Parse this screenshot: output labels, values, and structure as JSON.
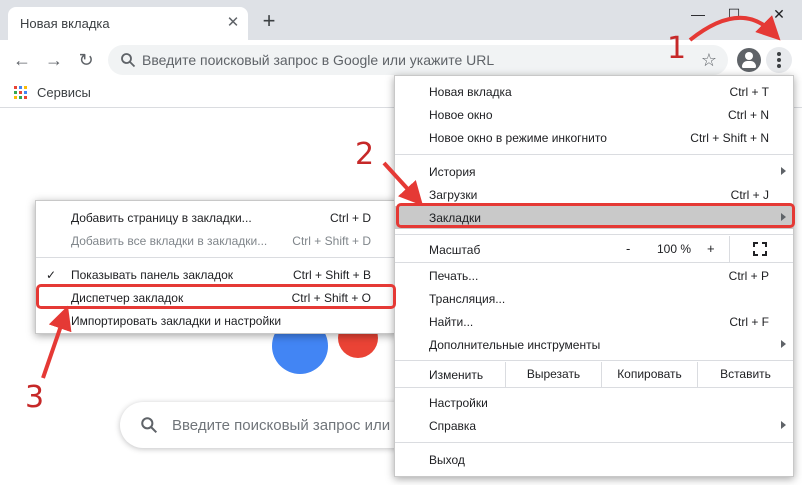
{
  "tab": {
    "title": "Новая вкладка",
    "close": "✕",
    "new_tab": "+"
  },
  "window": {
    "minimize": "—",
    "maximize": "☐",
    "close": "✕"
  },
  "toolbar": {
    "omnibox_placeholder": "Введите поисковый запрос в Google или укажите URL"
  },
  "bookmarks_bar": {
    "apps_label": "Сервисы"
  },
  "page": {
    "search_placeholder": "Введите поисковый запрос или"
  },
  "chrome_menu": {
    "items_top": [
      {
        "label": "Новая вкладка",
        "shortcut": "Ctrl + T"
      },
      {
        "label": "Новое окно",
        "shortcut": "Ctrl + N"
      },
      {
        "label": "Новое окно в режиме инкогнито",
        "shortcut": "Ctrl + Shift + N"
      }
    ],
    "items_mid": [
      {
        "label": "История",
        "shortcut": ""
      },
      {
        "label": "Загрузки",
        "shortcut": "Ctrl + J"
      },
      {
        "label": "Закладки",
        "shortcut": ""
      }
    ],
    "zoom": {
      "label": "Масштаб",
      "minus": "-",
      "value": "100 %",
      "plus": "+"
    },
    "items_tools": [
      {
        "label": "Печать...",
        "shortcut": "Ctrl + P"
      },
      {
        "label": "Трансляция...",
        "shortcut": ""
      },
      {
        "label": "Найти...",
        "shortcut": "Ctrl + F"
      },
      {
        "label": "Дополнительные инструменты",
        "shortcut": ""
      }
    ],
    "edit": {
      "label": "Изменить",
      "cut": "Вырезать",
      "copy": "Копировать",
      "paste": "Вставить"
    },
    "items_settings": [
      {
        "label": "Настройки",
        "shortcut": ""
      },
      {
        "label": "Справка",
        "shortcut": ""
      }
    ],
    "exit": {
      "label": "Выход"
    }
  },
  "bookmarks_menu": {
    "items": [
      {
        "label": "Добавить страницу в закладки...",
        "shortcut": "Ctrl + D"
      },
      {
        "label": "Добавить все вкладки в закладки...",
        "shortcut": "Ctrl + Shift + D"
      },
      {
        "label": "Показывать панель закладок",
        "shortcut": "Ctrl + Shift + B"
      },
      {
        "label": "Диспетчер закладок",
        "shortcut": "Ctrl + Shift + O"
      },
      {
        "label": "Импортировать закладки и настройки",
        "shortcut": ""
      }
    ]
  },
  "annotations": {
    "step1": "1",
    "step2": "2",
    "step3": "3",
    "accent_color": "#e53935"
  }
}
